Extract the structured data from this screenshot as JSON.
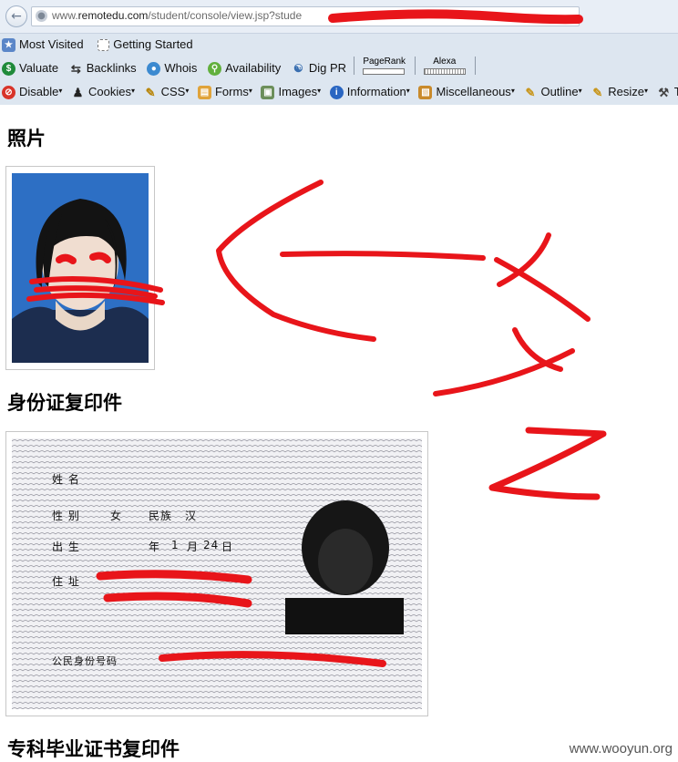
{
  "browser": {
    "url_prefix": "www.",
    "url_domain": "remotedu.com",
    "url_path": "/student/console/view.jsp?stude",
    "bookmarks": [
      "Most Visited",
      "Getting Started"
    ],
    "seo_toolbar": [
      "Valuate",
      "Backlinks",
      "Whois",
      "Availability",
      "Dig PR"
    ],
    "pagerank_label": "PageRank",
    "alexa_label": "Alexa",
    "devtools": [
      "Disable",
      "Cookies",
      "CSS",
      "Forms",
      "Images",
      "Information",
      "Miscellaneous",
      "Outline",
      "Resize",
      "To"
    ]
  },
  "page": {
    "section_photo": "照片",
    "section_id_copy": "身份证复印件",
    "section_diploma_copy": "专科毕业证书复印件"
  },
  "id_card": {
    "name_label": "姓  名",
    "sex_label": "性  别",
    "sex_value": "女",
    "ethnicity_label": "民族",
    "ethnicity_value": "汉",
    "birth_label": "出  生",
    "birth_month": "1",
    "month_unit": "月",
    "birth_day": "24",
    "day_unit": "日",
    "year_unit": "年",
    "address_label": "住  址",
    "id_number_label": "公民身份号码"
  },
  "watermark": "www.wooyun.org",
  "colors": {
    "annotation_red": "#e8151a",
    "photo_background": "#2d6fc4"
  }
}
